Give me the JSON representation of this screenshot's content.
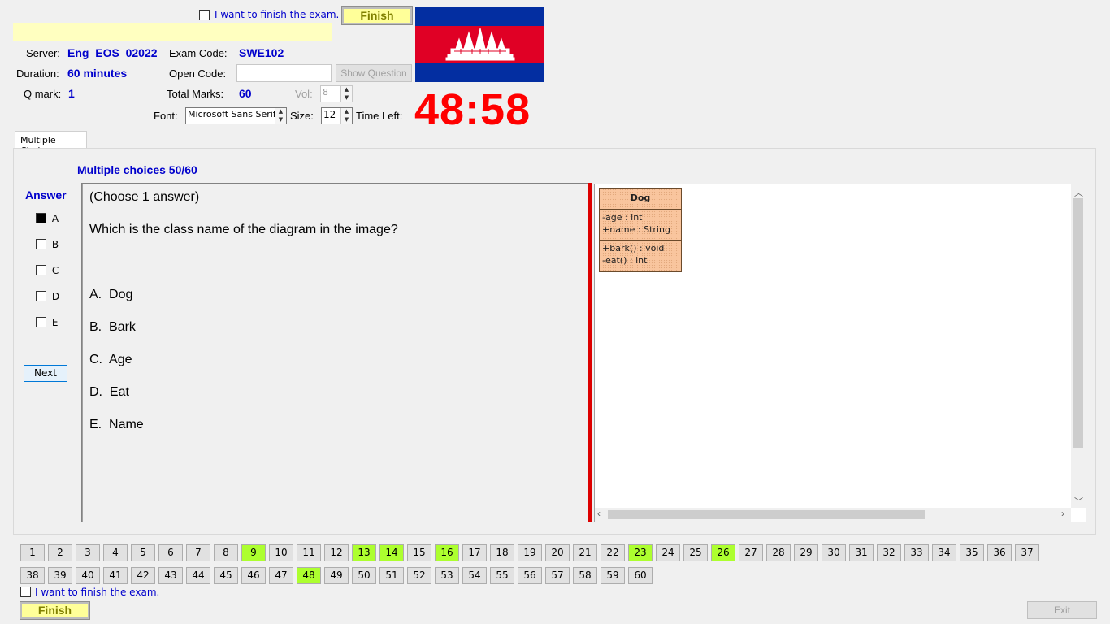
{
  "top": {
    "finish_check_label": "I want to finish the exam.",
    "finish_button": "Finish"
  },
  "info": {
    "server_label": "Server:",
    "server_value": "Eng_EOS_02022",
    "exam_code_label": "Exam Code:",
    "exam_code_value": "SWE102",
    "duration_label": "Duration:",
    "duration_value": "60 minutes",
    "open_code_label": "Open Code:",
    "open_code_value": "",
    "show_question_button": "Show Question",
    "qmark_label": "Q mark:",
    "qmark_value": "1",
    "total_marks_label": "Total Marks:",
    "total_marks_value": "60",
    "vol_label": "Vol:",
    "vol_value": "8",
    "font_label": "Font:",
    "font_value": "Microsoft Sans Serif",
    "size_label": "Size:",
    "size_value": "12",
    "time_left_label": "Time Left:",
    "time_left_value": "48:58"
  },
  "tab": {
    "label": "Multiple Choices"
  },
  "question": {
    "progress_title": "Multiple choices 50/60",
    "instruction": "(Choose 1 answer)",
    "text": "Which is the class name of the diagram in the image?",
    "options": [
      {
        "letter": "A.",
        "text": "Dog"
      },
      {
        "letter": "B.",
        "text": "Bark"
      },
      {
        "letter": "C.",
        "text": "Age"
      },
      {
        "letter": "D.",
        "text": "Eat"
      },
      {
        "letter": "E.",
        "text": "Name"
      }
    ]
  },
  "answer": {
    "title": "Answer",
    "choices": [
      {
        "label": "A",
        "checked": true
      },
      {
        "label": "B",
        "checked": false
      },
      {
        "label": "C",
        "checked": false
      },
      {
        "label": "D",
        "checked": false
      },
      {
        "label": "E",
        "checked": false
      }
    ],
    "next_button": "Next"
  },
  "uml": {
    "class_name": "Dog",
    "attributes": [
      "-age : int",
      "+name : String"
    ],
    "methods": [
      "+bark() : void",
      "-eat() : int"
    ]
  },
  "nav": {
    "answered": [
      9,
      13,
      14,
      16,
      23,
      26,
      48
    ],
    "row1": [
      1,
      2,
      3,
      4,
      5,
      6,
      7,
      8,
      9,
      10,
      11,
      12,
      13,
      14,
      15,
      16,
      17,
      18,
      19,
      20,
      21,
      22,
      23,
      24,
      25,
      26,
      27,
      28,
      29,
      30,
      31,
      32,
      33,
      34,
      35,
      36,
      37
    ],
    "row2": [
      38,
      39,
      40,
      41,
      42,
      43,
      44,
      45,
      46,
      47,
      48,
      49,
      50,
      51,
      52,
      53,
      54,
      55,
      56,
      57,
      58,
      59,
      60
    ]
  },
  "bottom": {
    "finish_check_label": "I want to finish the exam.",
    "finish_button": "Finish",
    "exit_button": "Exit"
  },
  "colors": {
    "timer": "#ff0000",
    "answered": "#adff2f",
    "accent_blue": "#0000cc",
    "flag_blue": "#032ea1",
    "flag_red": "#e00025"
  }
}
